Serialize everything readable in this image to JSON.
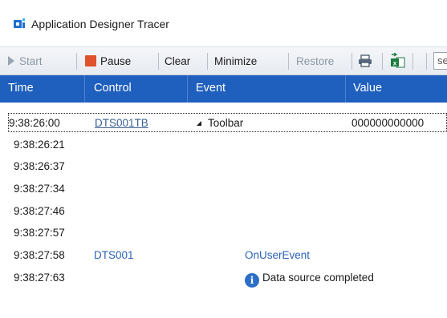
{
  "window": {
    "title": "Application Designer Tracer",
    "icon": "app-designer-icon"
  },
  "toolbar": {
    "start_label": "Start",
    "pause_label": "Pause",
    "clear_label": "Clear",
    "minimize_label": "Minimize",
    "restore_label": "Restore",
    "print_icon": "printer-icon",
    "excel_icon": "excel-export-icon",
    "search_value": "se",
    "pause_color": "#e0522c"
  },
  "grid": {
    "columns": [
      "Time",
      "Control",
      "Event",
      "Value"
    ],
    "header_color": "#1f5fbd",
    "rows": [
      {
        "time": "9:38:26:00",
        "control": "DTS001TB",
        "event": "Toolbar",
        "value": "000000000000"
      },
      {
        "time": "9:38:26:21",
        "control": "",
        "event": "",
        "value": ""
      },
      {
        "time": "9:38:26:37",
        "control": "",
        "event": "",
        "value": ""
      },
      {
        "time": "9:38:27:34",
        "control": "",
        "event": "",
        "value": ""
      },
      {
        "time": "9:38:27:46",
        "control": "",
        "event": "",
        "value": ""
      },
      {
        "time": "9:38:27:57",
        "control": "",
        "event": "",
        "value": ""
      },
      {
        "time": "9:38:27:58",
        "control": "DTS001",
        "event": "OnUserEvent",
        "value": ""
      },
      {
        "time": "9:38:27:63",
        "control": "",
        "event": "Data source completed",
        "value": ""
      }
    ]
  }
}
